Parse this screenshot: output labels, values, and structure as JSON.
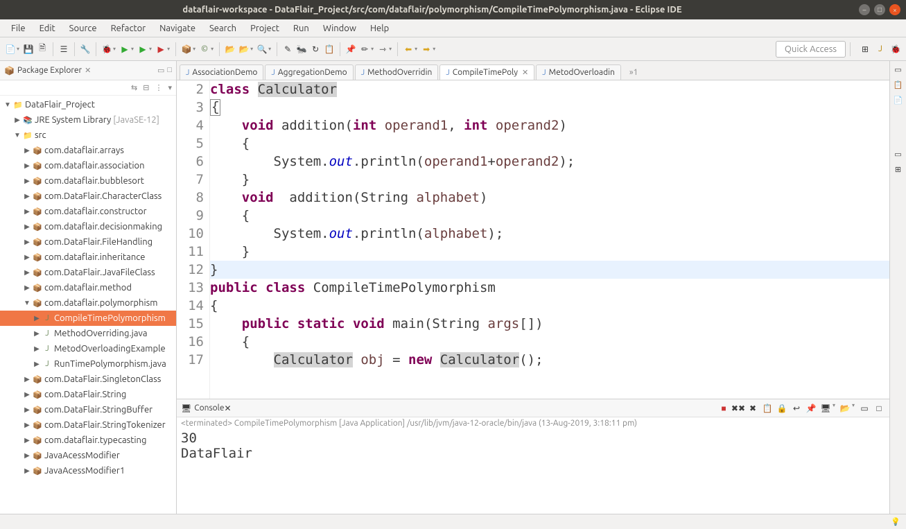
{
  "window": {
    "title": "dataflair-workspace - DataFlair_Project/src/com/dataflair/polymorphism/CompileTimePolymorphism.java - Eclipse IDE"
  },
  "menu": {
    "file": "File",
    "edit": "Edit",
    "source": "Source",
    "refactor": "Refactor",
    "navigate": "Navigate",
    "search": "Search",
    "project": "Project",
    "run": "Run",
    "window": "Window",
    "help": "Help"
  },
  "quick_access": "Quick Access",
  "package_explorer": {
    "title": "Package Explorer",
    "project": "DataFlair_Project",
    "jre": "JRE System Library",
    "jre_version": "[JavaSE-12]",
    "src": "src",
    "packages": [
      "com.dataflair.arrays",
      "com.dataflair.association",
      "com.dataflair.bubblesort",
      "com.DataFlair.CharacterClass",
      "com.dataflair.constructor",
      "com.dataflair.decisionmaking",
      "com.DataFlair.FileHandling",
      "com.dataflair.inheritance",
      "com.DataFlair.JavaFileClass",
      "com.dataflair.method",
      "com.dataflair.polymorphism"
    ],
    "poly_files": [
      "CompileTimePolymorphism",
      "MethodOverriding.java",
      "MetodOverloadingExample",
      "RunTimePolymorphism.java"
    ],
    "packages_after": [
      "com.DataFlair.SingletonClass",
      "com.DataFlair.String",
      "com.DataFlair.StringBuffer",
      "com.DataFlair.StringTokenizer",
      "com.dataflair.typecasting",
      "JavaAcessModifier",
      "JavaAcessModifier1"
    ]
  },
  "editor_tabs": {
    "t1": "AssociationDemo",
    "t2": "AggregationDemo",
    "t3": "MethodOverridin",
    "t4": "CompileTimePoly",
    "t5": "MetodOverloadin",
    "overflow": "»1"
  },
  "code": {
    "l2": {
      "kw": "class",
      "cls": "Calculator"
    },
    "l3": "{",
    "l4": {
      "kw": "void",
      "name": "addition",
      "kw2": "int",
      "p1": "operand1",
      "kw3": "int",
      "p2": "operand2"
    },
    "l5": "    {",
    "l6": {
      "pre": "        System.",
      "out": "out",
      "mid": ".println(",
      "a1": "operand1",
      "plus": "+",
      "a2": "operand2",
      "end": ");"
    },
    "l7": "    }",
    "l8": {
      "kw": "void",
      "name": "addition",
      "ptype": "String",
      "p1": "alphabet"
    },
    "l9": "    {",
    "l10": {
      "pre": "        System.",
      "out": "out",
      "mid": ".println(",
      "a1": "alphabet",
      "end": ");"
    },
    "l11": "    }",
    "l12": "}",
    "l13": {
      "kw1": "public",
      "kw2": "class",
      "cls": "CompileTimePolymorphism"
    },
    "l14": "{",
    "l15": {
      "kw1": "public",
      "kw2": "static",
      "kw3": "void",
      "name": "main",
      "ptype": "String",
      "p": "args"
    },
    "l16": "    {",
    "l17": {
      "cls": "Calculator",
      "var": "obj",
      "kw": "new",
      "cls2": "Calculator"
    }
  },
  "line_numbers": [
    "2",
    "3",
    "4",
    "5",
    "6",
    "7",
    "8",
    "9",
    "10",
    "11",
    "12",
    "13",
    "14",
    "15",
    "16",
    "17"
  ],
  "console": {
    "title": "Console",
    "info": "<terminated> CompileTimePolymorphism [Java Application] /usr/lib/jvm/java-12-oracle/bin/java (13-Aug-2019, 3:18:11 pm)",
    "output": "30\nDataFlair"
  }
}
